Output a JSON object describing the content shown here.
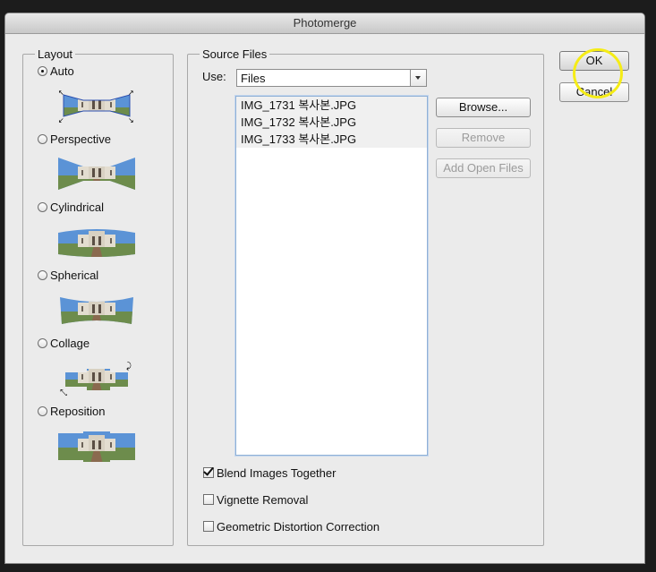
{
  "window": {
    "title": "Photomerge"
  },
  "layout_group": {
    "legend": "Layout",
    "options": [
      {
        "label": "Auto",
        "selected": true
      },
      {
        "label": "Perspective",
        "selected": false
      },
      {
        "label": "Cylindrical",
        "selected": false
      },
      {
        "label": "Spherical",
        "selected": false
      },
      {
        "label": "Collage",
        "selected": false
      },
      {
        "label": "Reposition",
        "selected": false
      }
    ]
  },
  "source_files": {
    "legend": "Source Files",
    "use_label": "Use:",
    "use_value": "Files",
    "files": [
      "IMG_1731 복사본.JPG",
      "IMG_1732 복사본.JPG",
      "IMG_1733 복사본.JPG"
    ],
    "browse_label": "Browse...",
    "remove_label": "Remove",
    "add_open_label": "Add Open Files",
    "blend_label": "Blend Images Together",
    "blend_checked": true,
    "vignette_label": "Vignette Removal",
    "vignette_checked": false,
    "geometric_label": "Geometric Distortion Correction",
    "geometric_checked": false
  },
  "buttons": {
    "ok_label": "OK",
    "cancel_label": "Cancel"
  },
  "colors": {
    "sky": "#5b93d6",
    "building": "#e3ddd0",
    "ground": "#8a6a4f",
    "grass": "#6d8c4c",
    "highlight": "#f5ec16"
  }
}
